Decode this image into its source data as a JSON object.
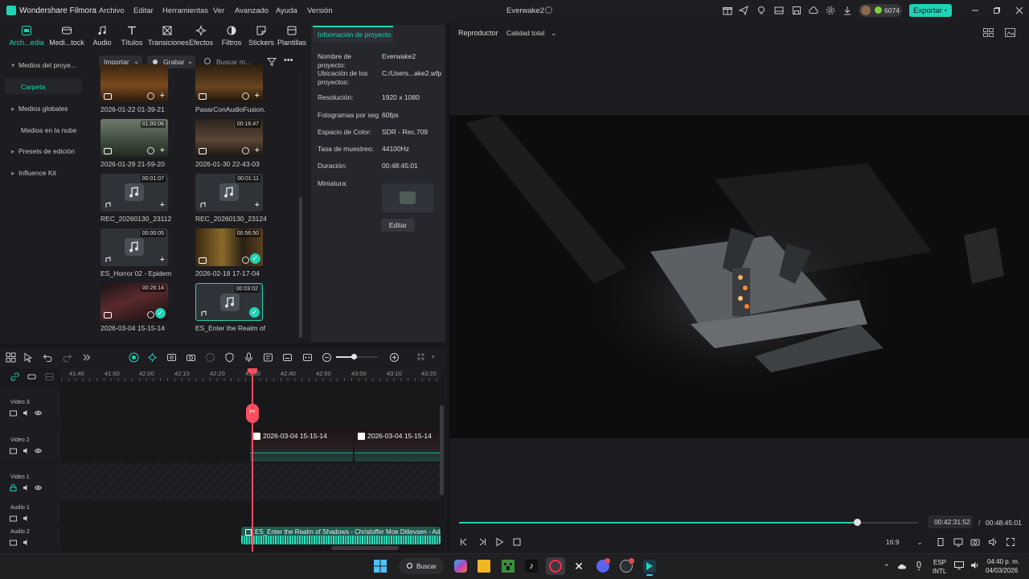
{
  "app": {
    "title": "Wondershare Filmora",
    "project_name": "Everwake2"
  },
  "menu": [
    "Archivo",
    "Editar",
    "Herramientas",
    "Ver",
    "Avanzado",
    "Ayuda",
    "Versión"
  ],
  "titlebar": {
    "credits": "6074",
    "export_label": "Exportar"
  },
  "categories": [
    {
      "label": "Arch...edia",
      "icon": "folder-icon",
      "active": true
    },
    {
      "label": "Medi...tock",
      "icon": "stock-media-icon"
    },
    {
      "label": "Audio",
      "icon": "music-note-icon"
    },
    {
      "label": "Títulos",
      "icon": "text-title-icon"
    },
    {
      "label": "Transiciones",
      "icon": "transitions-icon"
    },
    {
      "label": "Efectos",
      "icon": "effects-icon"
    },
    {
      "label": "Filtros",
      "icon": "filters-icon"
    },
    {
      "label": "Stickers",
      "icon": "stickers-icon"
    },
    {
      "label": "Plantillas",
      "icon": "templates-icon"
    }
  ],
  "sidebar": {
    "items": [
      {
        "label": "Medios del proye...",
        "caret": "▾"
      },
      {
        "label": "Carpeta",
        "caret": ""
      },
      {
        "label": "Medios globales",
        "caret": "▸"
      },
      {
        "label": "Medios en la nube",
        "caret": ""
      },
      {
        "label": "Presets de edición",
        "caret": "▸"
      },
      {
        "label": "Influence Kit",
        "caret": "▸"
      }
    ]
  },
  "media_toolbar": {
    "import_label": "Importar",
    "record_label": "Grabar",
    "search_placeholder": "Buscar m..."
  },
  "media": [
    {
      "name": "2026-01-22 01-39-21",
      "duration": "",
      "type": "video"
    },
    {
      "name": "PasarConAudioFusion...",
      "duration": "",
      "type": "video"
    },
    {
      "name": "2026-01-29 21-59-20",
      "duration": "01:00:06",
      "type": "video"
    },
    {
      "name": "2026-01-30 22-43-03",
      "duration": "00:16:47",
      "type": "video"
    },
    {
      "name": "REC_20260130_231122",
      "duration": "00:01:07",
      "type": "audio"
    },
    {
      "name": "REC_20260130_231246",
      "duration": "00:01:11",
      "type": "audio"
    },
    {
      "name": "ES_Horror 02 - Epidem...",
      "duration": "00:00:05",
      "type": "audio"
    },
    {
      "name": "2026-02-18 17-17-04",
      "duration": "00:56:50",
      "type": "video"
    },
    {
      "name": "2026-03-04 15-15-14",
      "duration": "00:26:14",
      "type": "video"
    },
    {
      "name": "ES_Enter the Realm of ...",
      "duration": "00:03:02",
      "type": "audio"
    }
  ],
  "project_info": {
    "tab_label": "Información de proyecto",
    "rows": [
      {
        "label": "Nombre de proyecto:",
        "value": "Everwake2"
      },
      {
        "label": "Ubicación de los proyectos:",
        "value": "C:/Users...ake2.wfp"
      },
      {
        "label": "Resolución:",
        "value": "1920 x 1080"
      },
      {
        "label": "Fotogramas por seg",
        "value": "60fps"
      },
      {
        "label": "Espacio de Color:",
        "value": "SDR - Rec.709"
      },
      {
        "label": "Tasa de muestreo:",
        "value": "44100Hz"
      },
      {
        "label": "Duración:",
        "value": "00:48:45:01"
      },
      {
        "label": "Miniatura:",
        "value": ""
      }
    ],
    "edit_label": "Editar"
  },
  "player": {
    "label": "Reproductor",
    "quality": "Calidad total",
    "current_time": "00:42:31:52",
    "total_time": "00:48:45:01",
    "progress": 0.867,
    "aspect_ratio": "16:9"
  },
  "timeline": {
    "ruler_ticks": [
      "41:40",
      "41:50",
      "42:00",
      "42:10",
      "42:20",
      "42:30",
      "42:40",
      "42:50",
      "43:00",
      "43:10",
      "43:20"
    ],
    "tracks": [
      {
        "name": "Video 3"
      },
      {
        "name": "Video 2"
      },
      {
        "name": "Video 1"
      },
      {
        "name": "Audio 1"
      },
      {
        "name": "Audio 2"
      }
    ],
    "clips": [
      {
        "name": "2026-03-04 15-15-14",
        "track": "Video 2"
      },
      {
        "name": "2026-03-04 15-15-14",
        "track": "Video 2"
      },
      {
        "name": "ES_Enter the Realm of Shadows - Christoffer Moe Ditlevsen - Ada",
        "track": "Audio 2"
      }
    ]
  },
  "taskbar": {
    "search_label": "Buscar",
    "lang_top": "ESP",
    "lang_bottom": "INTL",
    "time": "04:40 p. m.",
    "date": "04/03/2026"
  },
  "colors": {
    "accent": "#1fd3b4",
    "bg_dark": "#161619",
    "panel": "#1d1d21",
    "playhead": "#ff4d5e"
  }
}
